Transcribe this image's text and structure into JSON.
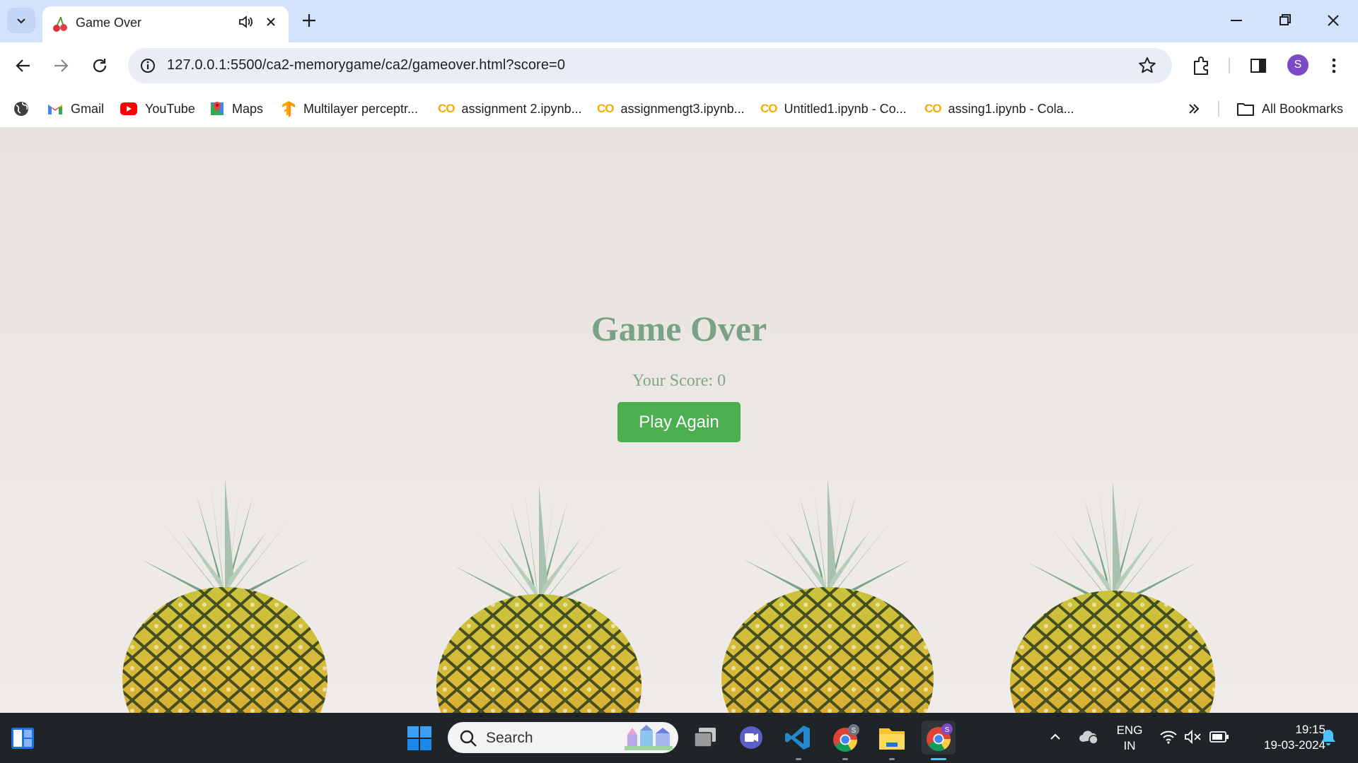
{
  "tab": {
    "title": "Game Over"
  },
  "omnibox": {
    "url": "127.0.0.1:5500/ca2-memorygame/ca2/gameover.html?score=0"
  },
  "profile": {
    "initial": "S"
  },
  "bookmarks": {
    "items": [
      {
        "label": "Gmail",
        "icon": "gmail-icon"
      },
      {
        "label": "YouTube",
        "icon": "youtube-icon"
      },
      {
        "label": "Maps",
        "icon": "maps-icon"
      },
      {
        "label": "Multilayer perceptr...",
        "icon": "tensorflow-icon"
      },
      {
        "label": "assignment 2.ipynb...",
        "icon": "colab-icon"
      },
      {
        "label": "assignmengt3.ipynb...",
        "icon": "colab-icon"
      },
      {
        "label": "Untitled1.ipynb - Co...",
        "icon": "colab-icon"
      },
      {
        "label": "assing1.ipynb - Cola...",
        "icon": "colab-icon"
      }
    ],
    "colab_mark": "CO",
    "all_label": "All Bookmarks"
  },
  "page": {
    "title": "Game Over",
    "score_text": "Your Score: 0",
    "play_again": "Play Again"
  },
  "taskbar": {
    "search_label": "Search",
    "lang_top": "ENG",
    "lang_bottom": "IN",
    "time": "19:15",
    "date": "19-03-2024",
    "chrome_badge": "S"
  },
  "colors": {
    "accent_button": "#4caf50",
    "title_text": "#7aa287",
    "tabstrip": "#d3e3fd",
    "profile": "#7b4bc3"
  }
}
